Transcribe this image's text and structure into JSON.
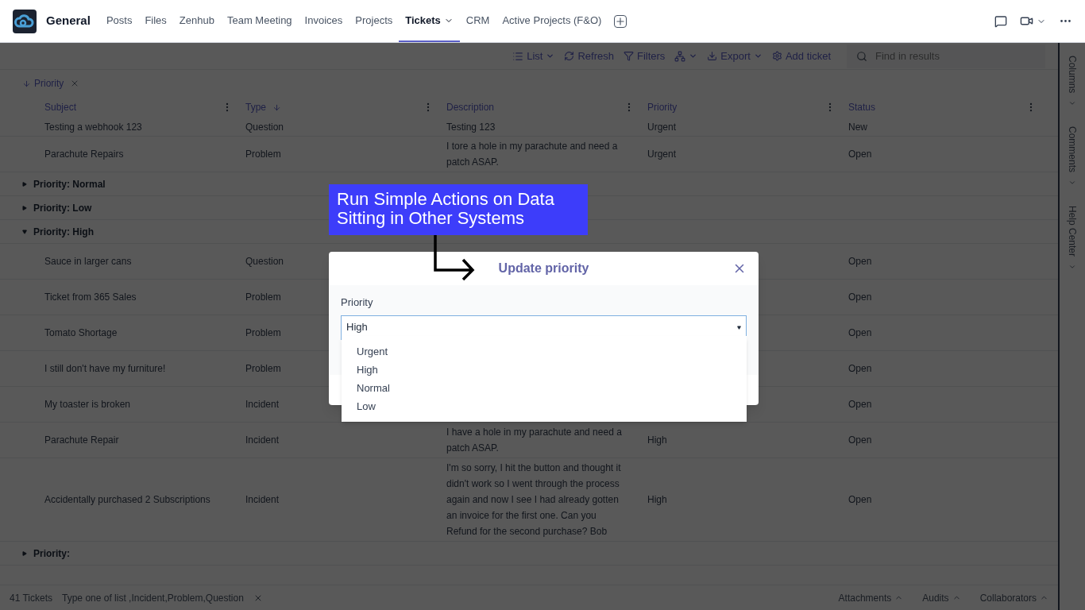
{
  "app": {
    "title": "General",
    "tabs": [
      {
        "label": "Posts",
        "selected": false,
        "dropdown": false
      },
      {
        "label": "Files",
        "selected": false,
        "dropdown": false
      },
      {
        "label": "Zenhub",
        "selected": false,
        "dropdown": false
      },
      {
        "label": "Team Meeting",
        "selected": false,
        "dropdown": false
      },
      {
        "label": "Invoices",
        "selected": false,
        "dropdown": false
      },
      {
        "label": "Projects",
        "selected": false,
        "dropdown": false
      },
      {
        "label": "Tickets",
        "selected": true,
        "dropdown": true
      },
      {
        "label": "CRM",
        "selected": false,
        "dropdown": false
      },
      {
        "label": "Active Projects (F&O)",
        "selected": false,
        "dropdown": false
      }
    ]
  },
  "toolbar": {
    "view": "List",
    "refresh": "Refresh",
    "filters": "Filters",
    "export": "Export",
    "add": "Add ticket",
    "search_placeholder": "Find in results"
  },
  "sort_chip": "Priority",
  "table": {
    "columns": [
      {
        "label": "Subject",
        "sorted": false
      },
      {
        "label": "Type",
        "sorted": true
      },
      {
        "label": "Description",
        "sorted": false
      },
      {
        "label": "Priority",
        "sorted": false
      },
      {
        "label": "Status",
        "sorted": false
      }
    ],
    "rows": [
      {
        "kind": "ticket",
        "cells": [
          "Testing a webhook 123",
          "Question",
          "Testing 123",
          "Urgent",
          "New"
        ]
      },
      {
        "kind": "ticket",
        "cells": [
          "Parachute Repairs",
          "Problem",
          "I tore a hole in my parachute and need a patch ASAP.",
          "Urgent",
          "Open"
        ]
      },
      {
        "kind": "group",
        "label": "Priority: Normal",
        "expanded": false
      },
      {
        "kind": "group",
        "label": "Priority: Low",
        "expanded": false
      },
      {
        "kind": "group",
        "label": "Priority: High",
        "expanded": true
      },
      {
        "kind": "ticket",
        "cells": [
          "Sauce in larger cans",
          "Question",
          null,
          null,
          "Open"
        ]
      },
      {
        "kind": "ticket",
        "cells": [
          "Ticket from 365 Sales",
          "Problem",
          null,
          null,
          "Open"
        ]
      },
      {
        "kind": "ticket",
        "cells": [
          "Tomato Shortage",
          "Problem",
          null,
          null,
          "Open"
        ]
      },
      {
        "kind": "ticket",
        "cells": [
          "I still don't have my furniture!",
          "Problem",
          null,
          null,
          "Open"
        ]
      },
      {
        "kind": "ticket",
        "cells": [
          "My toaster is broken",
          "Incident",
          null,
          null,
          "Open"
        ]
      },
      {
        "kind": "ticket",
        "cells": [
          "Parachute Repair",
          "Incident",
          "I have a hole in my parachute and need a patch ASAP.",
          "High",
          "Open"
        ]
      },
      {
        "kind": "ticket",
        "cells": [
          "Accidentally purchased 2 Subscriptions",
          "Incident",
          "I'm so sorry, I hit the button and thought it didn't work so I went through the process again and now I see I had already gotten an invoice for the first one. Can you Refund for the second purchase? Bob",
          "High",
          "Open"
        ]
      },
      {
        "kind": "group",
        "label": "Priority:",
        "expanded": false
      }
    ]
  },
  "side_panels": [
    "Columns",
    "Comments",
    "Help Center"
  ],
  "footer": {
    "count": "41 Tickets",
    "filter": "Type one of list ,Incident,Problem,Question",
    "panels": [
      "Attachments",
      "Audits",
      "Collaborators"
    ]
  },
  "callout": "Run Simple Actions on Data Sitting in Other Systems",
  "dialog": {
    "title": "Update priority",
    "field_label": "Priority",
    "value": "High",
    "options": [
      "Urgent",
      "High",
      "Normal",
      "Low"
    ]
  }
}
